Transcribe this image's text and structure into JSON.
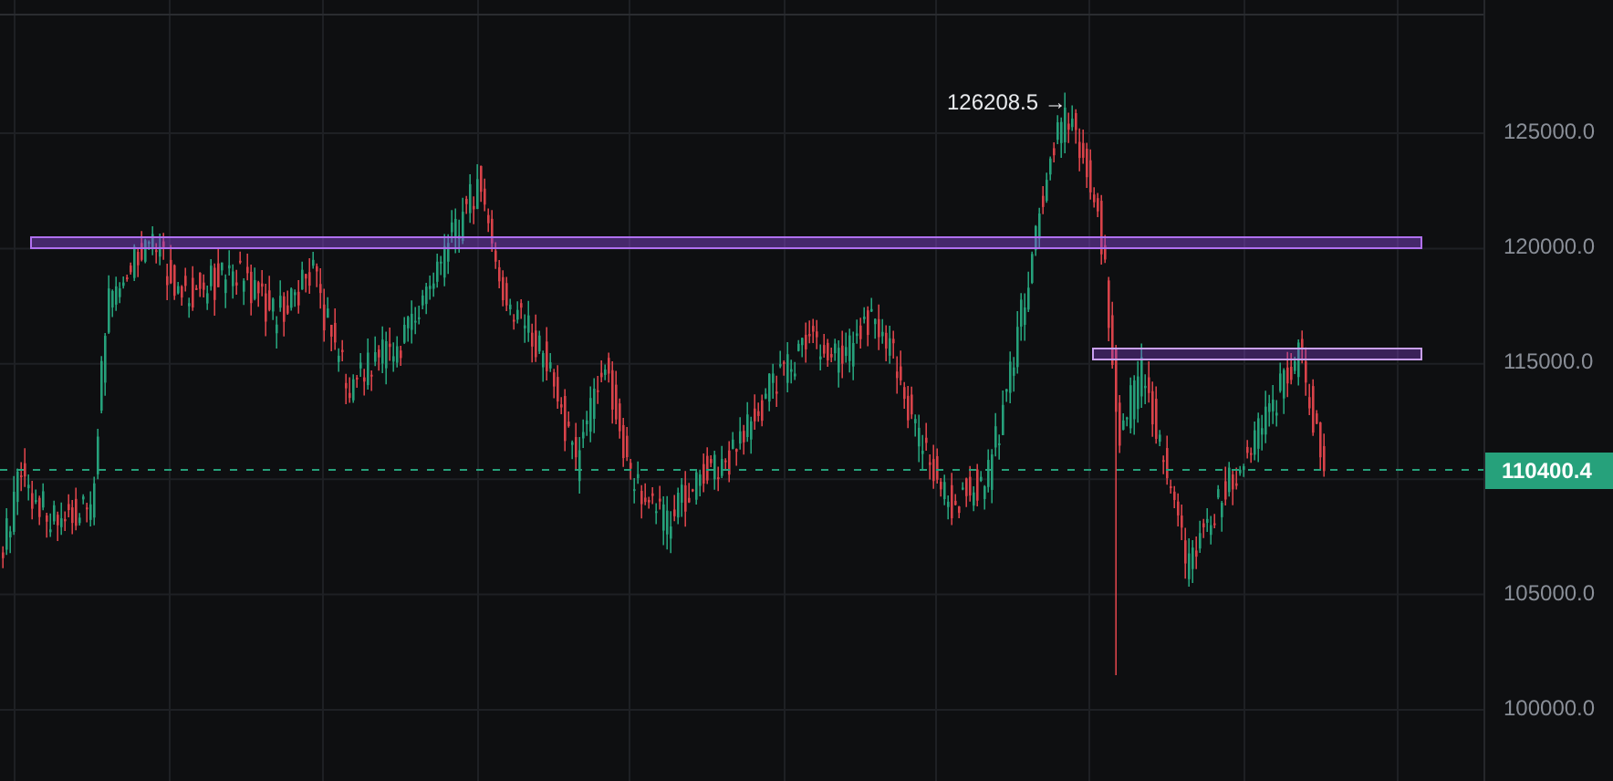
{
  "chart": {
    "high_marker": "126208.5 →",
    "current_price": "110400.4",
    "price_axis": [
      "125000.0",
      "120000.0",
      "115000.0",
      "105000.0",
      "100000.0"
    ]
  }
}
